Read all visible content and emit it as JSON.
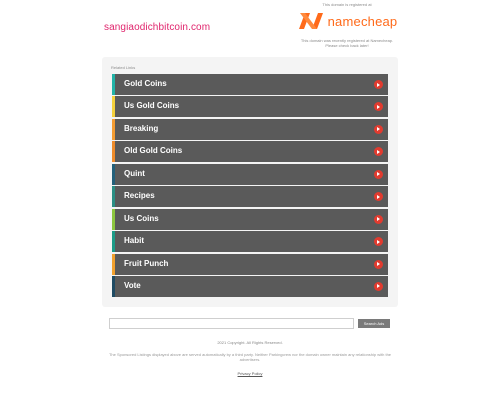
{
  "header": {
    "domain": "sangiaodichbitcoin.com",
    "brand_top": "This domain is registered at",
    "brand_name": "namecheap",
    "brand_note_line1": "This domain was recently registered at Namecheap.",
    "brand_note_line2": "Please check back later!"
  },
  "related": {
    "heading": "Related Links",
    "items": [
      {
        "label": "Gold Coins",
        "accent": "#22b3a7"
      },
      {
        "label": "Us Gold Coins",
        "accent": "#f4d13c"
      },
      {
        "label": "Breaking",
        "accent": "#f39c33"
      },
      {
        "label": "Old Gold Coins",
        "accent": "#ef8c2b"
      },
      {
        "label": "Quint",
        "accent": "#23607a"
      },
      {
        "label": "Recipes",
        "accent": "#2b8f84"
      },
      {
        "label": "Us Coins",
        "accent": "#8cc63f"
      },
      {
        "label": "Habit",
        "accent": "#1c9b87"
      },
      {
        "label": "Fruit Punch",
        "accent": "#f2a12d"
      },
      {
        "label": "Vote",
        "accent": "#1f4b63"
      }
    ],
    "arrow_color": "#e23b2f"
  },
  "search": {
    "placeholder": "",
    "button_label": "Search Ads"
  },
  "footer": {
    "copyright": "2021 Copyright. All Rights Reserved.",
    "disclaimer_line1": "The Sponsored Listings displayed above are served automatically by a third party. Neither Parkingcrew nor the domain owner maintain any relationship with the",
    "disclaimer_line2": "advertisers.",
    "privacy": "Privacy Policy"
  },
  "colors": {
    "logo_orange": "#ff6a1a",
    "domain_pink": "#e0246c",
    "panel_bar": "#5a5a5a"
  }
}
